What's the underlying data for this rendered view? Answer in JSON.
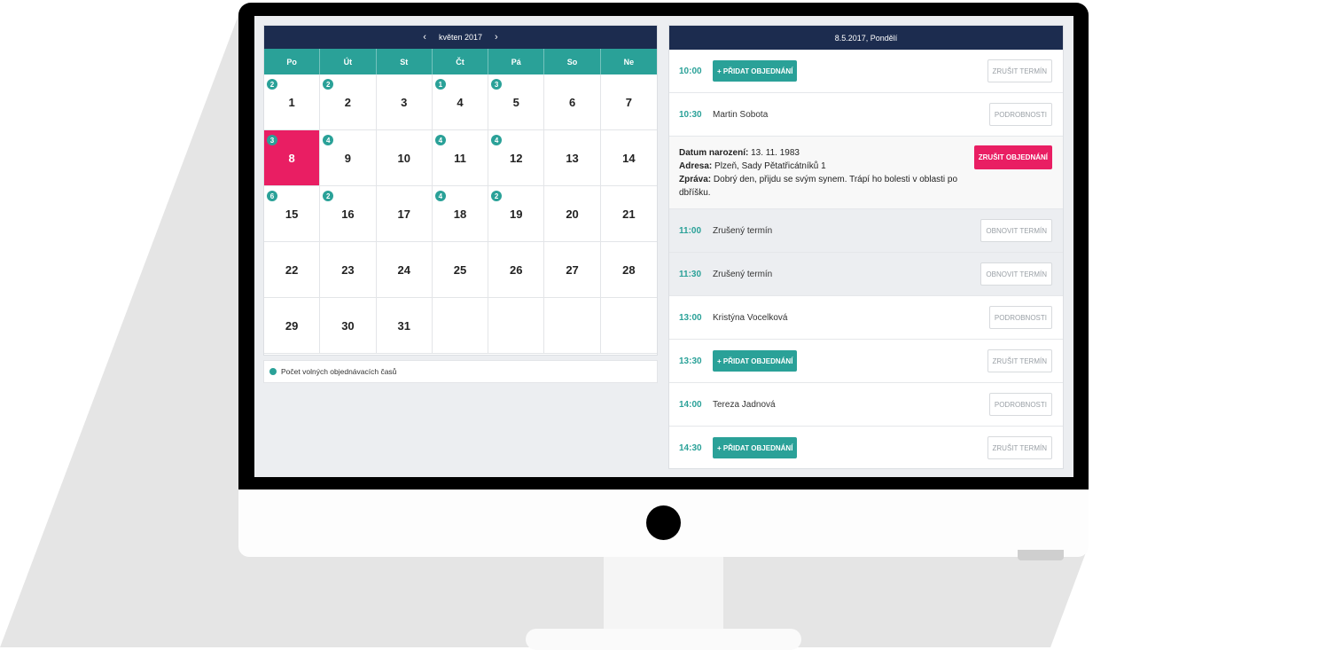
{
  "calendar": {
    "month_label": "květen 2017",
    "prev_icon": "‹",
    "next_icon": "›",
    "weekdays": [
      "Po",
      "Út",
      "St",
      "Čt",
      "Pá",
      "So",
      "Ne"
    ],
    "days": [
      {
        "d": "1",
        "badge": "2"
      },
      {
        "d": "2",
        "badge": "2"
      },
      {
        "d": "3",
        "badge": ""
      },
      {
        "d": "4",
        "badge": "1"
      },
      {
        "d": "5",
        "badge": "3"
      },
      {
        "d": "6",
        "badge": ""
      },
      {
        "d": "7",
        "badge": ""
      },
      {
        "d": "8",
        "badge": "3",
        "selected": true
      },
      {
        "d": "9",
        "badge": "4"
      },
      {
        "d": "10",
        "badge": ""
      },
      {
        "d": "11",
        "badge": "4"
      },
      {
        "d": "12",
        "badge": "4"
      },
      {
        "d": "13",
        "badge": ""
      },
      {
        "d": "14",
        "badge": ""
      },
      {
        "d": "15",
        "badge": "6"
      },
      {
        "d": "16",
        "badge": "2"
      },
      {
        "d": "17",
        "badge": ""
      },
      {
        "d": "18",
        "badge": "4"
      },
      {
        "d": "19",
        "badge": "2"
      },
      {
        "d": "20",
        "badge": ""
      },
      {
        "d": "21",
        "badge": ""
      },
      {
        "d": "22",
        "badge": ""
      },
      {
        "d": "23",
        "badge": ""
      },
      {
        "d": "24",
        "badge": ""
      },
      {
        "d": "25",
        "badge": ""
      },
      {
        "d": "26",
        "badge": ""
      },
      {
        "d": "27",
        "badge": ""
      },
      {
        "d": "28",
        "badge": ""
      },
      {
        "d": "29",
        "badge": ""
      },
      {
        "d": "30",
        "badge": ""
      },
      {
        "d": "31",
        "badge": ""
      },
      {
        "d": "",
        "badge": ""
      },
      {
        "d": "",
        "badge": ""
      },
      {
        "d": "",
        "badge": ""
      },
      {
        "d": "",
        "badge": ""
      }
    ],
    "legend_text": "Počet volných objednávacích časů"
  },
  "schedule": {
    "header_date": "8.5.2017, Pondělí",
    "slots": [
      {
        "time": "10:00",
        "add_label": "+ PŘIDAT OBJEDNÁNÍ",
        "action": "ZRUŠIT TERMÍN"
      },
      {
        "time": "10:30",
        "name": "Martin Sobota",
        "action": "PODROBNOSTI"
      },
      {
        "time": "11:00",
        "name": "Zrušený termín",
        "action": "OBNOVIT TERMÍN"
      },
      {
        "time": "11:30",
        "name": "Zrušený termín",
        "action": "OBNOVIT TERMÍN"
      },
      {
        "time": "13:00",
        "name": "Kristýna Vocelková",
        "action": "PODROBNOSTI"
      },
      {
        "time": "13:30",
        "add_label": "+ PŘIDAT OBJEDNÁNÍ",
        "action": "ZRUŠIT TERMÍN"
      },
      {
        "time": "14:00",
        "name": "Tereza Jadnová",
        "action": "PODROBNOSTI"
      },
      {
        "time": "14:30",
        "add_label": "+ PŘIDAT OBJEDNÁNÍ",
        "action": "ZRUŠIT TERMÍN"
      }
    ],
    "details": {
      "birth_label": "Datum narození:",
      "birth_value": "13. 11. 1983",
      "address_label": "Adresa:",
      "address_value": "Plzeň, Sady Pětatřicátníků 1",
      "message_label": "Zpráva:",
      "message_value": "Dobrý den, přijdu se svým synem. Trápí ho bolesti v oblasti po dbříšku.",
      "cancel_label": "ZRUŠIT OBJEDNÁNÍ"
    }
  },
  "colors": {
    "navy": "#1c2c4f",
    "teal": "#2aa198",
    "pink": "#e91e63"
  }
}
